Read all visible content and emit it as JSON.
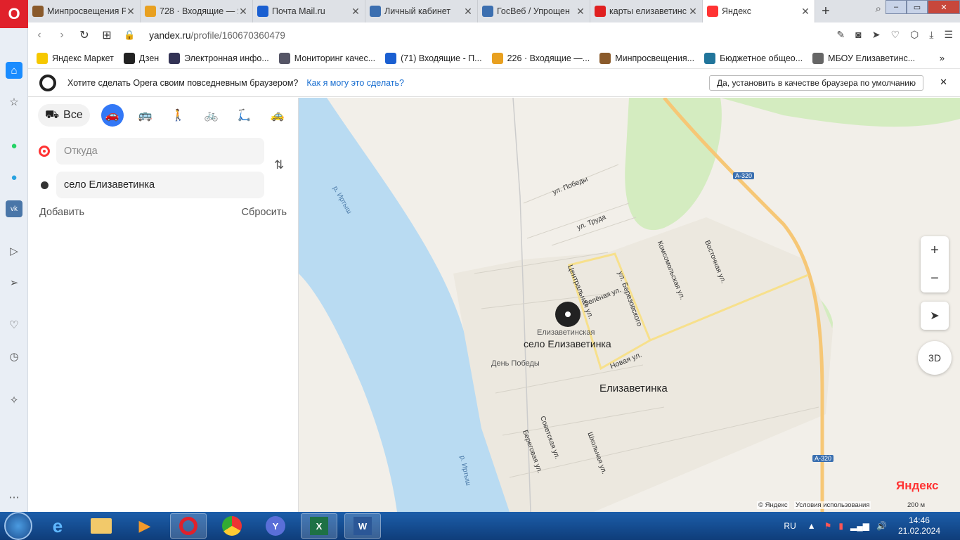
{
  "tabs": [
    {
      "title": "Минпросвещения Р",
      "icon": "emblem-icon",
      "color": "#8a5a2b"
    },
    {
      "title": "728 · Входящие — Я",
      "icon": "mail-icon",
      "color": "#e8a020"
    },
    {
      "title": "Почта Mail.ru",
      "icon": "mailru-icon",
      "color": "#1a5fd1"
    },
    {
      "title": "Личный кабинет",
      "icon": "emblem-icon",
      "color": "#3c6fb0"
    },
    {
      "title": "ГосВеб / Упрощен",
      "icon": "emblem-icon",
      "color": "#3c6fb0"
    },
    {
      "title": "карты елизаветинс",
      "icon": "yandex-icon",
      "color": "#e02020"
    },
    {
      "title": "Яндекс",
      "icon": "map-pin-icon",
      "color": "#f33"
    }
  ],
  "url": {
    "domain": "yandex.ru",
    "path": "/profile/160670360479"
  },
  "bookmarks": [
    {
      "label": "Яндекс Маркет",
      "color": "#f6c800"
    },
    {
      "label": "Дзен",
      "color": "#222"
    },
    {
      "label": "Электронная инфо...",
      "color": "#335"
    },
    {
      "label": "Мониторинг качес...",
      "color": "#556"
    },
    {
      "label": "(71) Входящие - П...",
      "color": "#1a5fd1"
    },
    {
      "label": "226 · Входящие —...",
      "color": "#e8a020"
    },
    {
      "label": "Минпросвещения...",
      "color": "#8a5a2b"
    },
    {
      "label": "Бюджетное общео...",
      "color": "#21759b"
    },
    {
      "label": "МБОУ Елизаветинс...",
      "color": "#666"
    }
  ],
  "notification": {
    "question": "Хотите сделать Opera своим повседневным браузером?",
    "how": "Как я могу это сделать?",
    "set_default": "Да, установить в качестве браузера по умолчанию"
  },
  "route": {
    "mode_all": "Все",
    "from_placeholder": "Откуда",
    "to_value": "село Елизаветинка",
    "add": "Добавить",
    "reset": "Сбросить"
  },
  "map": {
    "labels": {
      "river1": "р. Иртыш",
      "river2": "р. Иртыш",
      "pobedy": "ул. Победы",
      "truda": "ул. Труда",
      "zelenaya": "Зелёная ул.",
      "centralnaya": "Центральная ул.",
      "berezovskogo": "ул. Березовского",
      "komsomolskaya": "Комсомольская ул.",
      "vostochnaya": "Восточная ул.",
      "novaya": "Новая ул.",
      "sovetskaya": "Советская ул.",
      "beregovaya": "Береговая ул.",
      "shkolnaya": "Школьная ул.",
      "school": "Елизаветинская",
      "selo": "село Елизаветинка",
      "den_pobedy": "День Победы",
      "village": "Елизаветинка",
      "a320_1": "A-320",
      "a320_2": "A-320"
    },
    "zoom_in": "+",
    "zoom_out": "−",
    "btn_3d": "3D",
    "logo": "Яндекс",
    "copyright": "© Яндекс",
    "terms": "Условия использования",
    "scale": "200 м"
  },
  "taskbar": {
    "lang": "RU",
    "time": "14:46",
    "date": "21.02.2024"
  }
}
